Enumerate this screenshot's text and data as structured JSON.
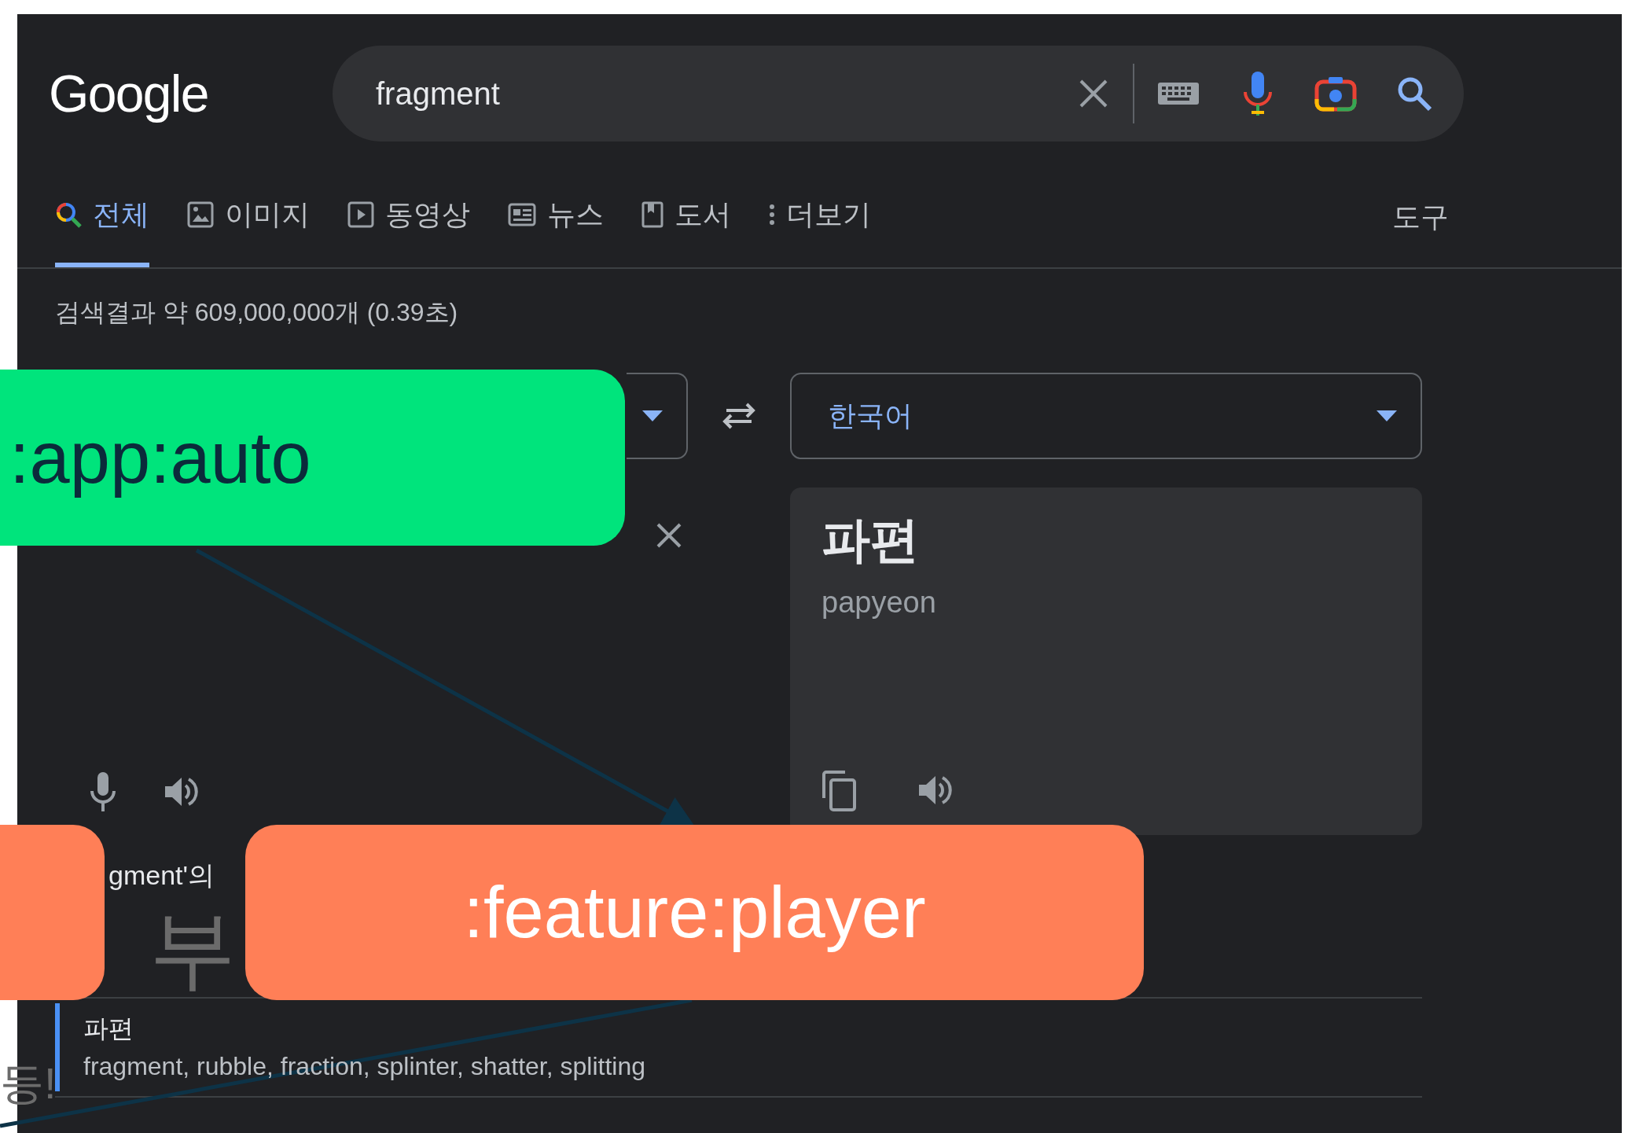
{
  "search": {
    "logo": "Google",
    "query": "fragment"
  },
  "tabs": [
    {
      "label": "전체",
      "kind": "search",
      "selected": true
    },
    {
      "label": "이미지",
      "kind": "image",
      "selected": false
    },
    {
      "label": "동영상",
      "kind": "video",
      "selected": false
    },
    {
      "label": "뉴스",
      "kind": "news",
      "selected": false
    },
    {
      "label": "도서",
      "kind": "book",
      "selected": false
    },
    {
      "label": "더보기",
      "kind": "more",
      "selected": false
    }
  ],
  "tools": "도구",
  "result_stats": "검색결과 약 609,000,000개 (0.39초)",
  "translator": {
    "target_language": "한국어",
    "translation": "파편",
    "romanization": "papyeon"
  },
  "dictionary": {
    "heading": "gment'의",
    "entries": [
      {
        "word": "파편",
        "synonyms": "fragment, rubble, fraction, splinter, shatter, splitting"
      }
    ]
  },
  "background_text": [
    "부",
    "등!"
  ],
  "overlays": [
    {
      "label": ":app:auto",
      "color": "#00e47c"
    },
    {
      "color": "#ff7f57"
    },
    {
      "label": ":feature:player",
      "color": "#ff7f57"
    }
  ]
}
